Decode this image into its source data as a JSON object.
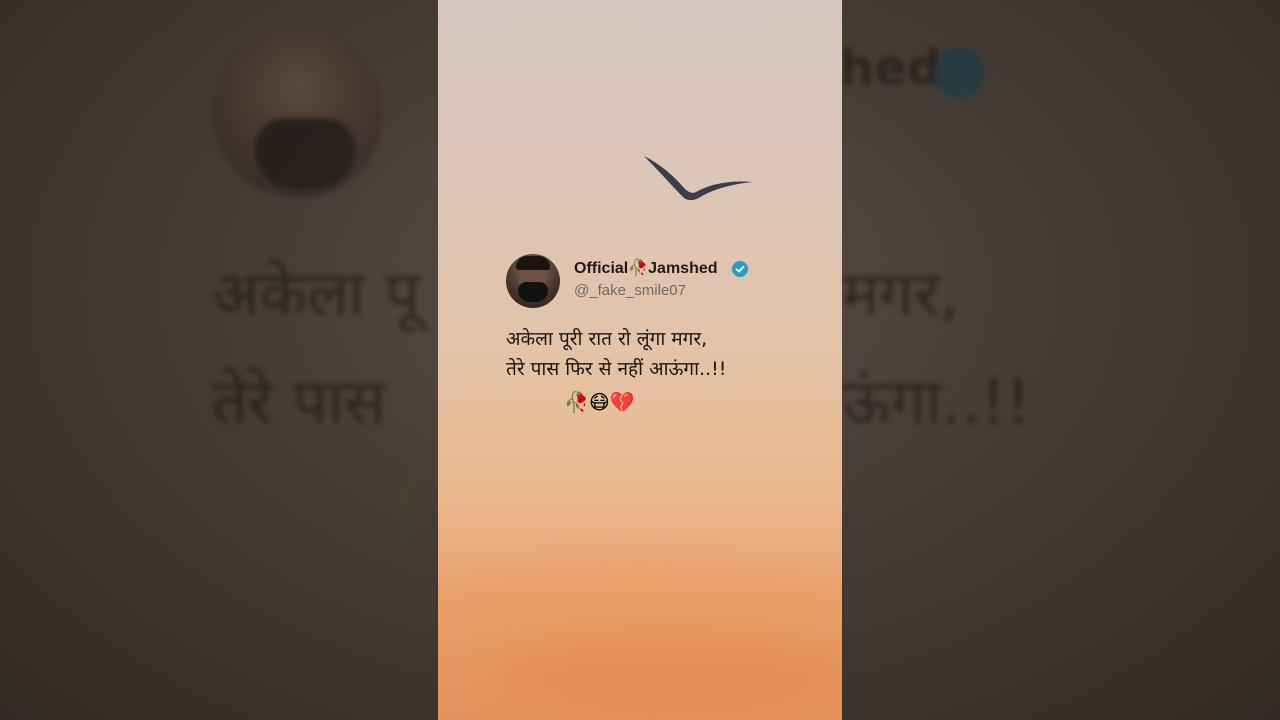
{
  "tweet": {
    "display_name": "Official🥀Jamshed",
    "handle": "@_fake_smile07",
    "verified": true,
    "line1": "अकेला पूरी रात रो लूंगा मगर,",
    "line2": "तेरे पास फिर से नहीं आऊंगा..!!",
    "emojis": "🥀😷💔"
  },
  "backdrop": {
    "name_fragment": "hed",
    "line1_left": "अकेला पू",
    "line1_right": "मगर,",
    "line2_left": "तेरे पास",
    "line2_right": "ऊंगा..!!"
  },
  "colors": {
    "verified_badge": "#2a9bc4",
    "sky_top": "#d8c8c2",
    "sky_bottom": "#e2925a"
  },
  "icons": {
    "verified": "verified-check-icon",
    "bird": "bird-silhouette"
  }
}
